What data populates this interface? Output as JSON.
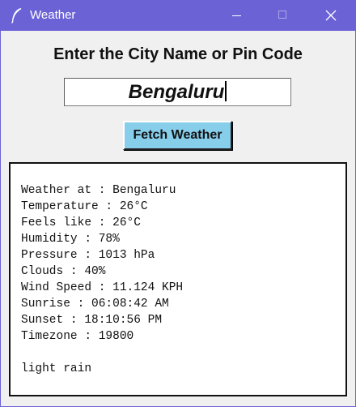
{
  "window": {
    "title": "Weather",
    "icon": "feather-icon",
    "controls": [
      "minimize-icon",
      "maximize-icon",
      "close-icon"
    ]
  },
  "main": {
    "heading": "Enter the City Name or Pin Code",
    "city_input_value": "Bengaluru",
    "fetch_button_label": "Fetch Weather"
  },
  "output": {
    "lines": [
      "Weather at : Bengaluru",
      "Temperature : 26°C",
      "Feels like : 26°C",
      "Humidity : 78%",
      "Pressure : 1013 hPa",
      "Clouds : 40%",
      "Wind Speed : 11.124 KPH",
      "Sunrise : 06:08:42 AM",
      "Sunset : 18:10:56 PM",
      "Timezone : 19800"
    ],
    "description": "light rain"
  },
  "colors": {
    "titlebar": "#6b62d6",
    "client_background": "#f0f0f0",
    "button_background": "#87ceeb"
  }
}
